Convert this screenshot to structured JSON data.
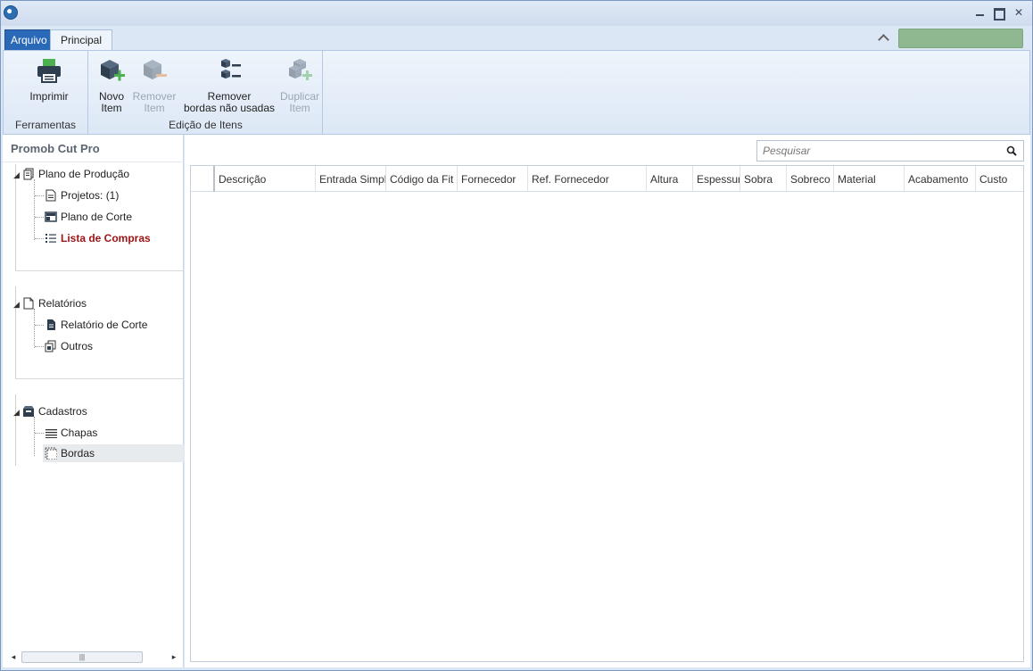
{
  "ribbon_tabs": {
    "file": "Arquivo",
    "home": "Principal"
  },
  "ribbon": {
    "tools": {
      "caption": "Ferramentas",
      "print_label": "Imprimir"
    },
    "edit": {
      "caption": "Edição de Itens",
      "new_item": [
        "Novo",
        "Item"
      ],
      "remove_item": [
        "Remover",
        "Item"
      ],
      "remove_edges": [
        "Remover",
        "bordas não usadas"
      ],
      "duplicate_item": [
        "Duplicar",
        "Item"
      ]
    }
  },
  "sidebar": {
    "title": "Promob Cut Pro",
    "sections": [
      {
        "label": "Plano de Produção",
        "children": [
          "Projetos: (1)",
          "Plano de Corte",
          "Lista de Compras"
        ]
      },
      {
        "label": "Relatórios",
        "children": [
          "Relatório de Corte",
          "Outros"
        ]
      },
      {
        "label": "Cadastros",
        "children": [
          "Chapas",
          "Bordas"
        ]
      }
    ],
    "active_item": "Lista de Compras",
    "selected_item": "Bordas"
  },
  "search": {
    "placeholder": "Pesquisar",
    "value": ""
  },
  "grid": {
    "columns": [
      "Descrição",
      "Entrada Simpl",
      "Código da Fit",
      "Fornecedor",
      "Ref. Fornecedor",
      "Altura",
      "Espessur",
      "Sobra",
      "Sobreco",
      "Material",
      "Acabamento",
      "Custo"
    ],
    "rows": []
  },
  "colors": {
    "file_tab": "#2a68b8",
    "active_tree_item": "#9e1414",
    "status_box": "#90b890"
  },
  "icons": [
    "app-logo-icon",
    "minimize-icon",
    "maximize-icon",
    "close-icon",
    "printer-icon",
    "new-item-icon",
    "remove-item-icon",
    "remove-edges-icon",
    "duplicate-item-icon",
    "search-icon"
  ]
}
